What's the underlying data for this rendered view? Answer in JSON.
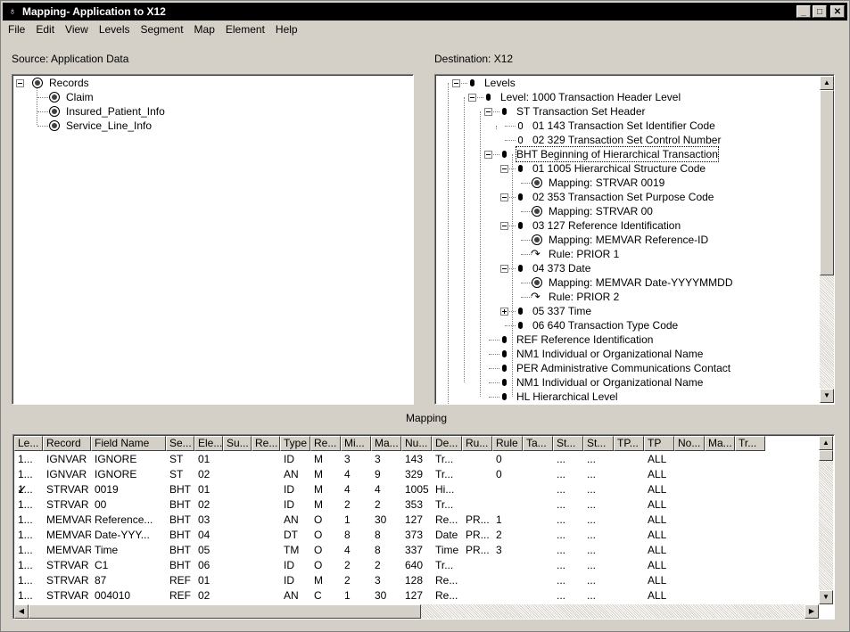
{
  "window": {
    "title": "Mapping-  Application to X12"
  },
  "menu": [
    "File",
    "Edit",
    "View",
    "Levels",
    "Segment",
    "Map",
    "Element",
    "Help"
  ],
  "source": {
    "label": "Source:  Application Data",
    "root": "Records",
    "children": [
      "Claim",
      "Insured_Patient_Info",
      "Service_Line_Info"
    ]
  },
  "destination": {
    "label": "Destination:  X12",
    "rows": [
      {
        "text": "Levels",
        "icon": "bullet"
      },
      {
        "text": "Level:   1000   Transaction Header Level",
        "icon": "bullet"
      },
      {
        "text": "ST    Transaction Set Header",
        "icon": "bullet"
      },
      {
        "text": "01     143     Transaction Set Identifier Code",
        "icon": "hollow"
      },
      {
        "text": "02     329     Transaction Set Control Number",
        "icon": "hollow"
      },
      {
        "text": "BHT   Beginning of Hierarchical Transaction",
        "icon": "bullet"
      },
      {
        "text": "01     1005     Hierarchical Structure Code",
        "icon": "bullet"
      },
      {
        "text": "Mapping:     STRVAR     0019",
        "icon": "globe"
      },
      {
        "text": "02     353     Transaction Set Purpose Code",
        "icon": "bullet"
      },
      {
        "text": "Mapping:     STRVAR     00",
        "icon": "globe"
      },
      {
        "text": "03     127     Reference Identification",
        "icon": "bullet"
      },
      {
        "text": "Mapping:     MEMVAR     Reference-ID",
        "icon": "globe"
      },
      {
        "text": "Rule:     PRIOR     1",
        "icon": "rule"
      },
      {
        "text": "04     373     Date",
        "icon": "bullet"
      },
      {
        "text": "Mapping:     MEMVAR     Date-YYYYMMDD",
        "icon": "globe"
      },
      {
        "text": "Rule:     PRIOR     2",
        "icon": "rule"
      },
      {
        "text": "05     337     Time",
        "icon": "bullet"
      },
      {
        "text": "06     640     Transaction Type Code",
        "icon": "bullet"
      },
      {
        "text": "REF   Reference Identification",
        "icon": "bullet"
      },
      {
        "text": "NM1   Individual or Organizational Name",
        "icon": "bullet"
      },
      {
        "text": "PER   Administrative Communications Contact",
        "icon": "bullet"
      },
      {
        "text": "NM1   Individual or Organizational Name",
        "icon": "bullet"
      },
      {
        "text": "HL    Hierarchical Level",
        "icon": "bullet"
      }
    ]
  },
  "mapping": {
    "label": "Mapping",
    "columns": [
      "Le...",
      "Record",
      "Field Name",
      "Se...",
      "Ele...",
      "Su...",
      "Re...",
      "Type",
      "Re...",
      "Mi...",
      "Ma...",
      "Nu...",
      "De...",
      "Ru...",
      "Rule",
      "Ta...",
      "St...",
      "St...",
      "TP...",
      "TP",
      "No...",
      "Ma...",
      "Tr..."
    ],
    "rows": [
      [
        "1...",
        "IGNVAR",
        "IGNORE",
        "ST",
        "01",
        "",
        "",
        "ID",
        "M",
        "3",
        "3",
        "143",
        "Tr...",
        "",
        "0",
        "",
        "...",
        "...",
        "",
        "ALL",
        "",
        "",
        ""
      ],
      [
        "1...",
        "IGNVAR",
        "IGNORE",
        "ST",
        "02",
        "",
        "",
        "AN",
        "M",
        "4",
        "9",
        "329",
        "Tr...",
        "",
        "0",
        "",
        "...",
        "...",
        "",
        "ALL",
        "",
        "",
        ""
      ],
      [
        "1...",
        "STRVAR",
        "0019",
        "BHT",
        "01",
        "",
        "",
        "ID",
        "M",
        "4",
        "4",
        "1005",
        "Hi...",
        "",
        "",
        "",
        "...",
        "...",
        "",
        "ALL",
        "",
        "",
        ""
      ],
      [
        "1...",
        "STRVAR",
        "00",
        "BHT",
        "02",
        "",
        "",
        "ID",
        "M",
        "2",
        "2",
        "353",
        "Tr...",
        "",
        "",
        "",
        "...",
        "...",
        "",
        "ALL",
        "",
        "",
        ""
      ],
      [
        "1...",
        "MEMVAR",
        "Reference...",
        "BHT",
        "03",
        "",
        "",
        "AN",
        "O",
        "1",
        "30",
        "127",
        "Re...",
        "PR...",
        "1",
        "",
        "...",
        "...",
        "",
        "ALL",
        "",
        "",
        ""
      ],
      [
        "1...",
        "MEMVAR",
        "Date-YYY...",
        "BHT",
        "04",
        "",
        "",
        "DT",
        "O",
        "8",
        "8",
        "373",
        "Date",
        "PR...",
        "2",
        "",
        "...",
        "...",
        "",
        "ALL",
        "",
        "",
        ""
      ],
      [
        "1...",
        "MEMVAR",
        "Time",
        "BHT",
        "05",
        "",
        "",
        "TM",
        "O",
        "4",
        "8",
        "337",
        "Time",
        "PR...",
        "3",
        "",
        "...",
        "...",
        "",
        "ALL",
        "",
        "",
        ""
      ],
      [
        "1...",
        "STRVAR",
        "C1",
        "BHT",
        "06",
        "",
        "",
        "ID",
        "O",
        "2",
        "2",
        "640",
        "Tr...",
        "",
        "",
        "",
        "...",
        "...",
        "",
        "ALL",
        "",
        "",
        ""
      ],
      [
        "1...",
        "STRVAR",
        "87",
        "REF",
        "01",
        "",
        "",
        "ID",
        "M",
        "2",
        "3",
        "128",
        "Re...",
        "",
        "",
        "",
        "...",
        "...",
        "",
        "ALL",
        "",
        "",
        ""
      ],
      [
        "1...",
        "STRVAR",
        "004010",
        "REF",
        "02",
        "",
        "",
        "AN",
        "C",
        "1",
        "30",
        "127",
        "Re...",
        "",
        "",
        "",
        "...",
        "...",
        "",
        "ALL",
        "",
        "",
        ""
      ]
    ],
    "checked_row": 2,
    "check_glyph": "✓"
  }
}
